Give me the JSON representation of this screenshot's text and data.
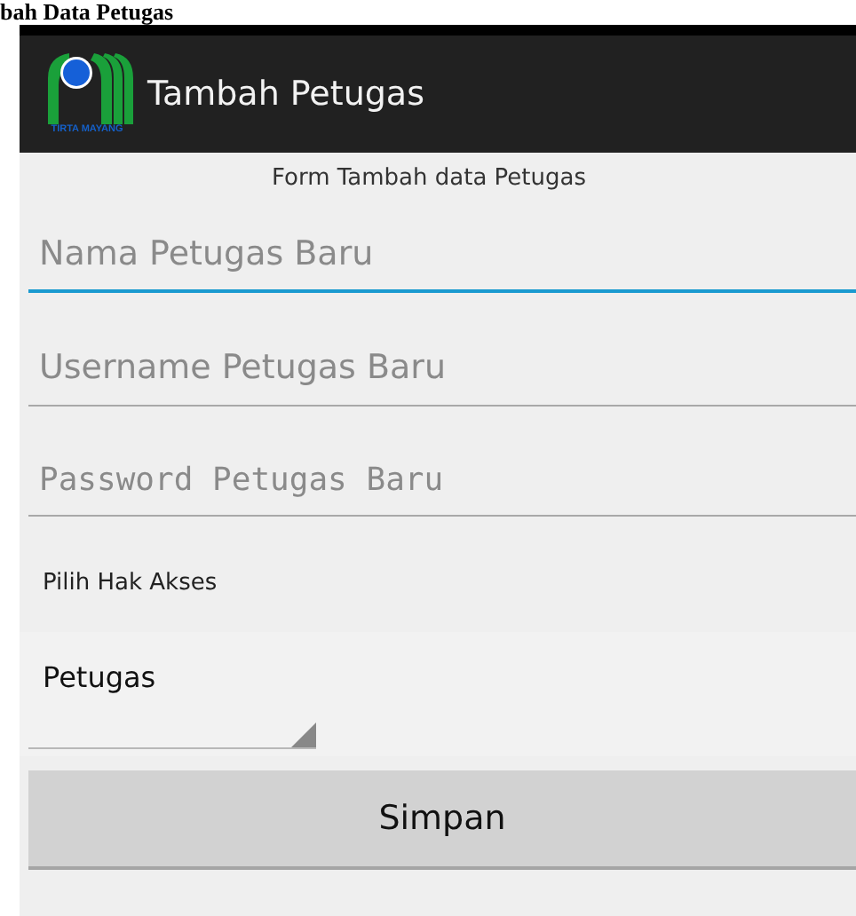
{
  "caption": "bah Data Petugas",
  "app_bar": {
    "logo_text": "TIRTA MAYANG",
    "title": "Tambah Petugas"
  },
  "form_title": "Form Tambah data Petugas",
  "fields": [
    {
      "placeholder": "Nama Petugas Baru",
      "kind": "text",
      "focused": true
    },
    {
      "placeholder": "Username Petugas Baru",
      "kind": "text",
      "focused": false
    },
    {
      "placeholder": "Password Petugas Baru",
      "kind": "password",
      "focused": false
    }
  ],
  "access_label": "Pilih Hak Akses",
  "spinner": {
    "value": "Petugas"
  },
  "save_button": "Simpan"
}
